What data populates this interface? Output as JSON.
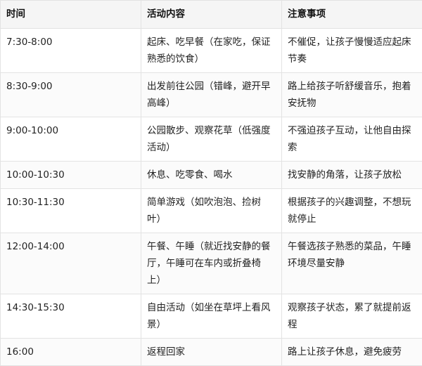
{
  "table": {
    "headers": [
      "时间",
      "活动内容",
      "注意事项"
    ],
    "rows": [
      [
        "7:30-8:00",
        "起床、吃早餐（在家吃，保证熟悉的饮食）",
        "不催促，让孩子慢慢适应起床节奏"
      ],
      [
        "8:30-9:00",
        "出发前往公园（错峰，避开早高峰）",
        "路上给孩子听舒缓音乐，抱着安抚物"
      ],
      [
        "9:00-10:00",
        "公园散步、观察花草（低强度活动）",
        "不强迫孩子互动，让他自由探索"
      ],
      [
        "10:00-10:30",
        "休息、吃零食、喝水",
        "找安静的角落，让孩子放松"
      ],
      [
        "10:30-11:30",
        "简单游戏（如吹泡泡、捡树叶）",
        "根据孩子的兴趣调整，不想玩就停止"
      ],
      [
        "12:00-14:00",
        "午餐、午睡（就近找安静的餐厅，午睡可在车内或折叠椅上）",
        "午餐选孩子熟悉的菜品，午睡环境尽量安静"
      ],
      [
        "14:30-15:30",
        "自由活动（如坐在草坪上看风景）",
        "观察孩子状态，累了就提前返程"
      ],
      [
        "16:00",
        "返程回家",
        "路上让孩子休息，避免疲劳"
      ]
    ]
  }
}
